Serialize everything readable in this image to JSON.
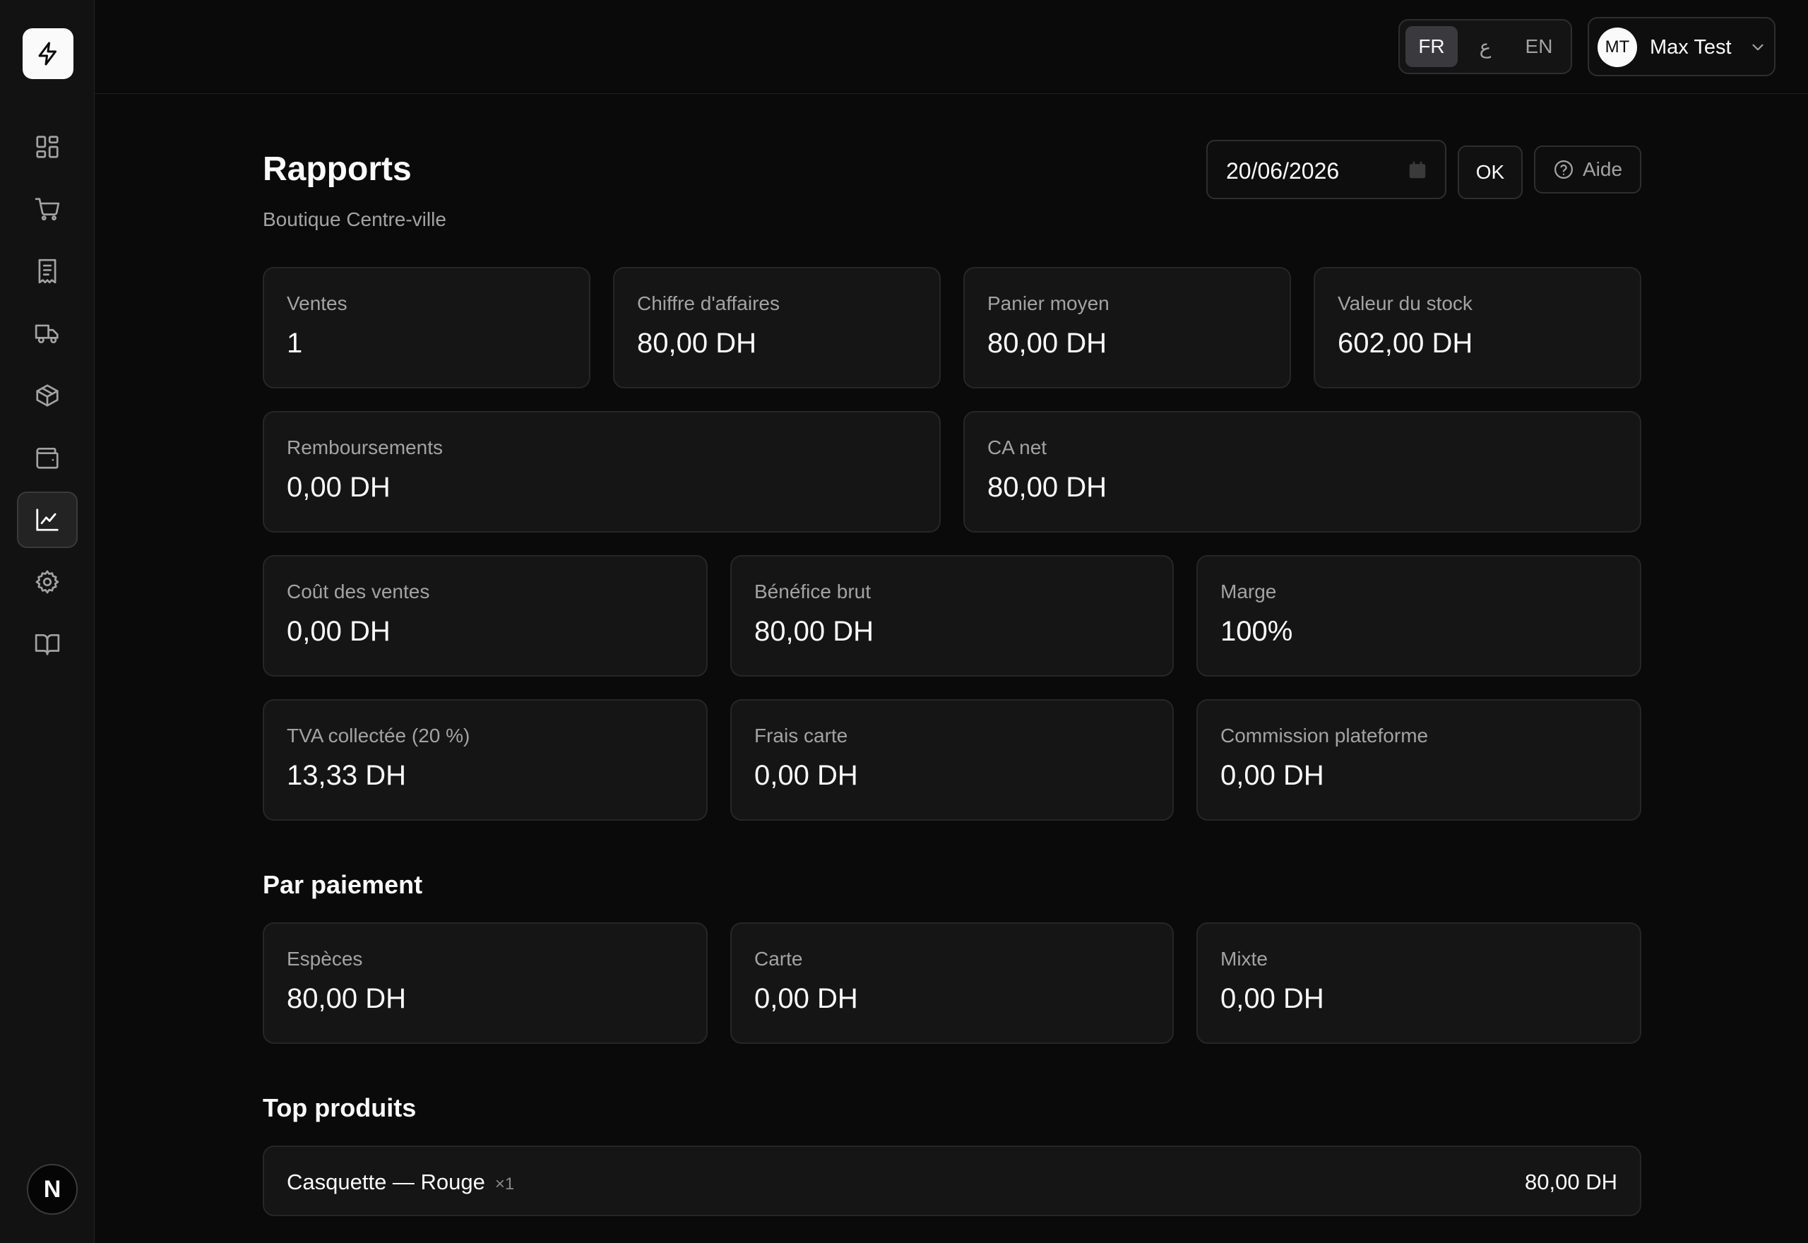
{
  "header": {
    "languages": [
      {
        "code": "FR",
        "active": true
      },
      {
        "code": "ع",
        "active": false
      },
      {
        "code": "EN",
        "active": false
      }
    ],
    "user": {
      "initials": "MT",
      "name": "Max Test"
    }
  },
  "sidebar": {
    "items": [
      {
        "icon": "dashboard-icon",
        "active": false
      },
      {
        "icon": "cart-icon",
        "active": false
      },
      {
        "icon": "receipt-icon",
        "active": false
      },
      {
        "icon": "truck-icon",
        "active": false
      },
      {
        "icon": "package-icon",
        "active": false
      },
      {
        "icon": "wallet-icon",
        "active": false
      },
      {
        "icon": "chart-line-icon",
        "active": true
      },
      {
        "icon": "settings-icon",
        "active": false
      },
      {
        "icon": "book-icon",
        "active": false
      }
    ],
    "bottom_badge": "N"
  },
  "page": {
    "title": "Rapports",
    "subtitle": "Boutique Centre-ville",
    "date": "20/06/2026",
    "ok_label": "OK",
    "help_label": "Aide"
  },
  "stats": [
    {
      "label": "Ventes",
      "value": "1"
    },
    {
      "label": "Chiffre d'affaires",
      "value": "80,00 DH"
    },
    {
      "label": "Panier moyen",
      "value": "80,00 DH"
    },
    {
      "label": "Valeur du stock",
      "value": "602,00 DH"
    },
    {
      "label": "Remboursements",
      "value": "0,00 DH"
    },
    {
      "label": "CA net",
      "value": "80,00 DH"
    },
    {
      "label": "Coût des ventes",
      "value": "0,00 DH"
    },
    {
      "label": "Bénéfice brut",
      "value": "80,00 DH"
    },
    {
      "label": "Marge",
      "value": "100%"
    },
    {
      "label": "TVA collectée (20 %)",
      "value": "13,33 DH"
    },
    {
      "label": "Frais carte",
      "value": "0,00 DH"
    },
    {
      "label": "Commission plateforme",
      "value": "0,00 DH"
    }
  ],
  "payment": {
    "title": "Par paiement",
    "items": [
      {
        "label": "Espèces",
        "value": "80,00 DH"
      },
      {
        "label": "Carte",
        "value": "0,00 DH"
      },
      {
        "label": "Mixte",
        "value": "0,00 DH"
      }
    ]
  },
  "top_products": {
    "title": "Top produits",
    "items": [
      {
        "name": "Casquette — Rouge",
        "qty": "×1",
        "total": "80,00 DH"
      }
    ]
  }
}
